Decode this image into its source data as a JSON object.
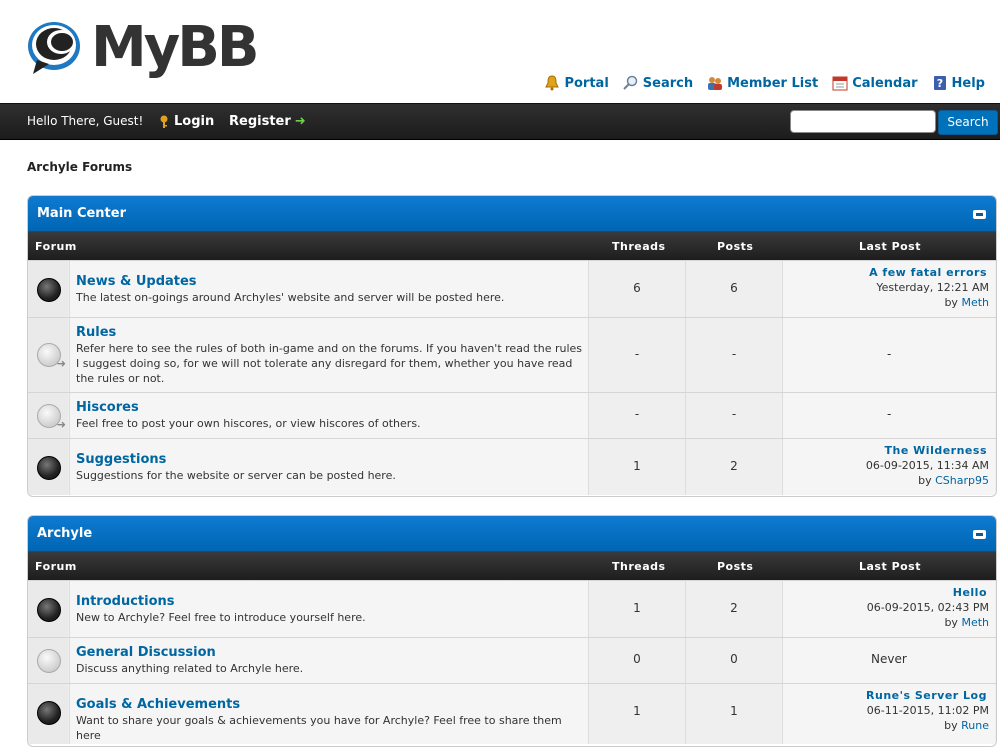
{
  "brand": {
    "name": "MyBB"
  },
  "toplinks": [
    {
      "label": "Portal",
      "icon": "bell-icon"
    },
    {
      "label": "Search",
      "icon": "magnifier-icon"
    },
    {
      "label": "Member List",
      "icon": "members-icon"
    },
    {
      "label": "Calendar",
      "icon": "calendar-icon"
    },
    {
      "label": "Help",
      "icon": "help-icon"
    }
  ],
  "panel": {
    "greeting": "Hello There, Guest!",
    "login": "Login",
    "register": "Register",
    "search_button": "Search",
    "search_value": ""
  },
  "breadcrumb": "Archyle Forums",
  "columns": {
    "forum": "Forum",
    "threads": "Threads",
    "posts": "Posts",
    "last_post": "Last Post"
  },
  "categories": [
    {
      "title": "Main Center",
      "forums": [
        {
          "name": "News & Updates",
          "desc": "The latest on-goings around Archyles' website and server will be posted here.",
          "threads": "6",
          "posts": "6",
          "status": "on",
          "last": {
            "title": "A few fatal errors",
            "date": "Yesterday, 12:21 AM",
            "by": "by",
            "user": "Meth"
          }
        },
        {
          "name": "Rules",
          "desc": "Refer here to see the rules of both in-game and on the forums. If you haven't read the rules I suggest doing so, for we will not tolerate any disregard for them, whether you have read the rules or not.",
          "threads": "-",
          "posts": "-",
          "status": "link",
          "last_text": "-"
        },
        {
          "name": "Hiscores",
          "desc": "Feel free to post your own hiscores, or view hiscores of others.",
          "threads": "-",
          "posts": "-",
          "status": "link",
          "last_text": "-"
        },
        {
          "name": "Suggestions",
          "desc": "Suggestions for the website or server can be posted here.",
          "threads": "1",
          "posts": "2",
          "status": "on",
          "last": {
            "title": "The Wilderness",
            "date": "06-09-2015, 11:34 AM",
            "by": "by",
            "user": "CSharp95"
          }
        }
      ]
    },
    {
      "title": "Archyle",
      "forums": [
        {
          "name": "Introductions",
          "desc": "New to Archyle? Feel free to introduce yourself here.",
          "threads": "1",
          "posts": "2",
          "status": "on",
          "last": {
            "title": "Hello",
            "date": "06-09-2015, 02:43 PM",
            "by": "by",
            "user": "Meth"
          }
        },
        {
          "name": "General Discussion",
          "desc": "Discuss anything related to Archyle here.",
          "threads": "0",
          "posts": "0",
          "status": "off",
          "last_text": "Never"
        },
        {
          "name": "Goals & Achievements",
          "desc": "Want to share your goals & achievements you have for Archyle? Feel free to share them here",
          "threads": "1",
          "posts": "1",
          "status": "on",
          "last": {
            "title": "Rune's Server Log",
            "date": "06-11-2015, 11:02 PM",
            "by": "by",
            "user": "Rune"
          }
        }
      ]
    }
  ],
  "colors": {
    "accent": "#0066a2",
    "thead": "#0072bc",
    "panel": "#1f1f1f"
  }
}
